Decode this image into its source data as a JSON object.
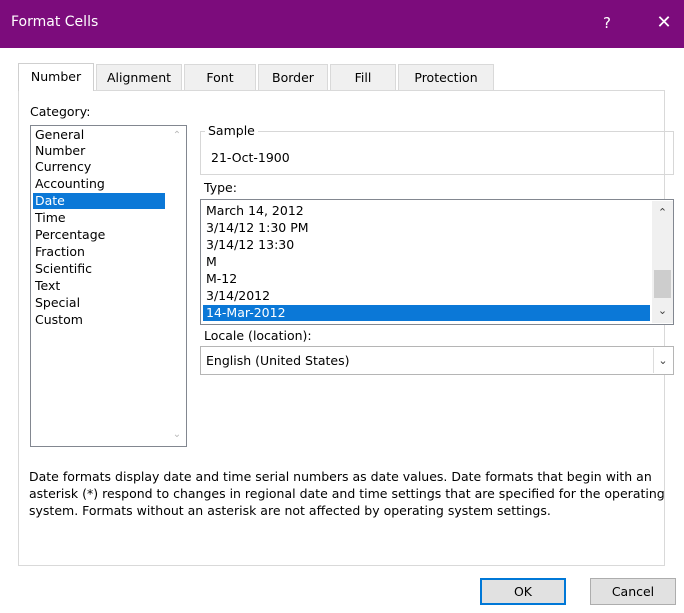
{
  "window": {
    "title": "Format Cells",
    "help_glyph": "?",
    "close_glyph": "✕",
    "icons": {
      "help": "help-icon",
      "close": "close-icon"
    },
    "accent_color": "#7c0c7c",
    "selection_color": "#0b78d7"
  },
  "tabs": [
    "Number",
    "Alignment",
    "Font",
    "Border",
    "Fill",
    "Protection"
  ],
  "active_tab": "Number",
  "category": {
    "label": "Category:",
    "items": [
      "General",
      "Number",
      "Currency",
      "Accounting",
      "Date",
      "Time",
      "Percentage",
      "Fraction",
      "Scientific",
      "Text",
      "Special",
      "Custom"
    ],
    "selected": "Date",
    "scroll_up_glyph": "⌃",
    "scroll_down_glyph": "⌄"
  },
  "sample": {
    "label": "Sample",
    "value": "21-Oct-1900"
  },
  "type": {
    "label": "Type:",
    "items": [
      "March 14, 2012",
      "3/14/12 1:30 PM",
      "3/14/12 13:30",
      "M",
      "M-12",
      "3/14/2012",
      "14-Mar-2012"
    ],
    "selected": "14-Mar-2012",
    "scroll_up_glyph": "⌃",
    "scroll_down_glyph": "⌄"
  },
  "locale": {
    "label": "Locale (location):",
    "value": "English (United States)",
    "dropdown_glyph": "⌄"
  },
  "description": "Date formats display date and time serial numbers as date values.  Date formats that begin with an asterisk (*) respond to changes in regional date and time settings that are specified for the operating system. Formats without an asterisk are not affected by operating system settings.",
  "buttons": {
    "ok": "OK",
    "cancel": "Cancel"
  }
}
